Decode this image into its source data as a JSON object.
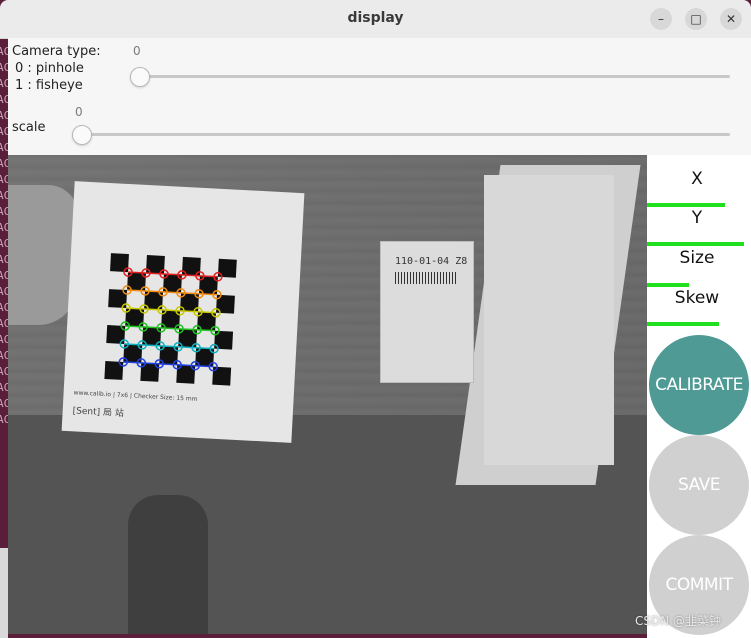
{
  "window": {
    "title": "display",
    "minimize_glyph": "–",
    "maximize_glyph": "□",
    "close_glyph": "✕"
  },
  "desktop": {
    "edge_text": "AC AC AC AC AC AC AC AC AC AC AC AC AC AC AC AC AC AC AC AC AC AC AC AC"
  },
  "trackbars": [
    {
      "label_lines": [
        "Camera type:",
        "0 : pinhole",
        "1 : fisheye"
      ],
      "value": "0",
      "position_fraction": 0
    },
    {
      "label_lines": [
        "scale"
      ],
      "value": "0",
      "position_fraction": 0
    }
  ],
  "camera_view": {
    "package_label": "110-01-04 Z8",
    "board_caption": "www.calib.io | 7x6 | Checker Size: 15 mm",
    "board_signature": "[Sent] 局 站"
  },
  "side_panel": {
    "metrics": [
      {
        "label": "X",
        "progress": 0.78
      },
      {
        "label": "Y",
        "progress": 0.97
      },
      {
        "label": "Size",
        "progress": 0.42
      },
      {
        "label": "Skew",
        "progress": 0.72
      }
    ],
    "buttons": {
      "calibrate": "CALIBRATE",
      "save": "SAVE",
      "commit": "COMMIT"
    }
  },
  "watermark": "CSDN @韭菜钟",
  "colors": {
    "progress_bar": "#1fe01f",
    "calibrate_active": "#4f9a94",
    "button_disabled": "#d0d0d0"
  }
}
